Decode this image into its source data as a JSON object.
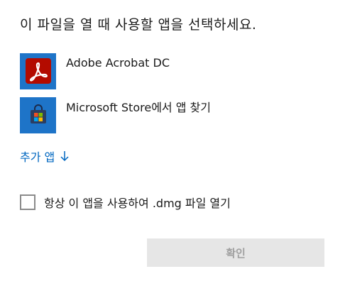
{
  "dialog": {
    "title": "이 파일을 열 때 사용할 앱을 선택하세요."
  },
  "apps": [
    {
      "label": "Adobe Acrobat DC",
      "icon": "adobe-acrobat-icon",
      "tile_color": "#1e74c8",
      "icon_color": "#b30b00"
    },
    {
      "label": "Microsoft Store에서 앱 찾기",
      "icon": "microsoft-store-icon",
      "tile_color": "#1e74c8"
    }
  ],
  "more_apps": {
    "label": "추가 앱",
    "icon": "arrow-down-icon",
    "color": "#0067c0"
  },
  "always_use": {
    "label": "항상 이 앱을 사용하여 .dmg 파일 열기",
    "checked": false
  },
  "ok_button": {
    "label": "확인",
    "enabled": false
  }
}
